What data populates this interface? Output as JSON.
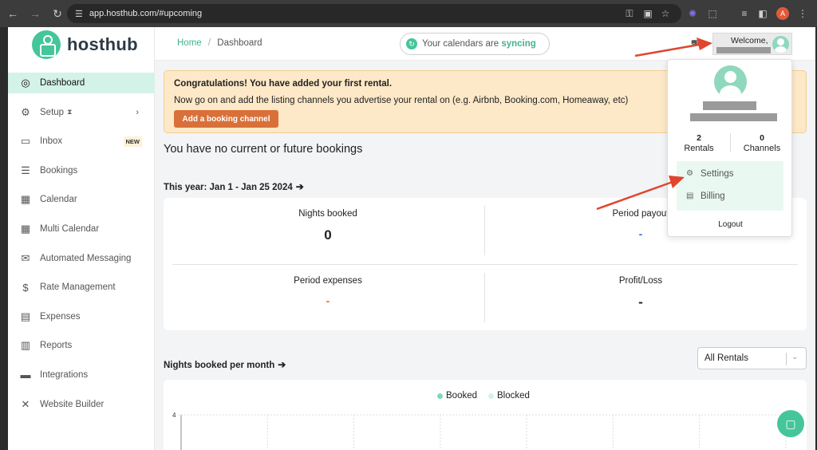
{
  "browser": {
    "url": "app.hosthub.com/#upcoming",
    "profile_initial": "A"
  },
  "sidebar": {
    "brand": "hosthub",
    "items": [
      {
        "label": "Dashboard",
        "icon": "target-icon"
      },
      {
        "label": "Setup",
        "icon": "gears-icon"
      },
      {
        "label": "Inbox",
        "icon": "inbox-icon",
        "badge": "NEW"
      },
      {
        "label": "Bookings",
        "icon": "list-icon"
      },
      {
        "label": "Calendar",
        "icon": "calendar-icon"
      },
      {
        "label": "Multi Calendar",
        "icon": "calendar-plus-icon"
      },
      {
        "label": "Automated Messaging",
        "icon": "envelope-icon"
      },
      {
        "label": "Rate Management",
        "icon": "dollar-icon"
      },
      {
        "label": "Expenses",
        "icon": "receipt-icon"
      },
      {
        "label": "Reports",
        "icon": "bar-chart-icon"
      },
      {
        "label": "Integrations",
        "icon": "store-icon"
      },
      {
        "label": "Website Builder",
        "icon": "tools-icon"
      }
    ]
  },
  "header": {
    "breadcrumb_home": "Home",
    "breadcrumb_sep": "/",
    "breadcrumb_current": "Dashboard",
    "sync_prefix": "Your calendars are",
    "sync_word": "syncing",
    "welcome": "Welcome,"
  },
  "alert": {
    "title": "Congratulations! You have added your first rental.",
    "body": "Now go on and add the listing channels you advertise your rental on (e.g. Airbnb, Booking.com, Homeaway, etc)",
    "button": "Add a booking channel"
  },
  "main": {
    "no_bookings": "You have no current or future bookings",
    "year_label": "This year: Jan 1 - Jan 25 2024",
    "stats": [
      {
        "label": "Nights booked",
        "value": "0"
      },
      {
        "label": "Period payout",
        "value": "-"
      },
      {
        "label": "Period expenses",
        "value": "-"
      },
      {
        "label": "Profit/Loss",
        "value": "-"
      }
    ],
    "nights_per_month": "Nights booked per month",
    "rental_select": "All Rentals"
  },
  "chart_data": {
    "type": "bar",
    "series": [
      {
        "name": "Booked",
        "color": "#7fd8b8",
        "values": []
      },
      {
        "name": "Blocked",
        "color": "#d4f3e8",
        "values": []
      }
    ],
    "y_tick_top": "4",
    "grid": true,
    "legend": "top-center"
  },
  "dropdown": {
    "rentals_count": "2",
    "rentals_label": "Rentals",
    "channels_count": "0",
    "channels_label": "Channels",
    "settings": "Settings",
    "billing": "Billing",
    "logout": "Logout"
  },
  "colors": {
    "brand": "#44c69a",
    "active_bg": "#d4f3e8",
    "alert_bg": "#fde8c7",
    "cta": "#d9703a",
    "annotation": "#e0452f"
  }
}
